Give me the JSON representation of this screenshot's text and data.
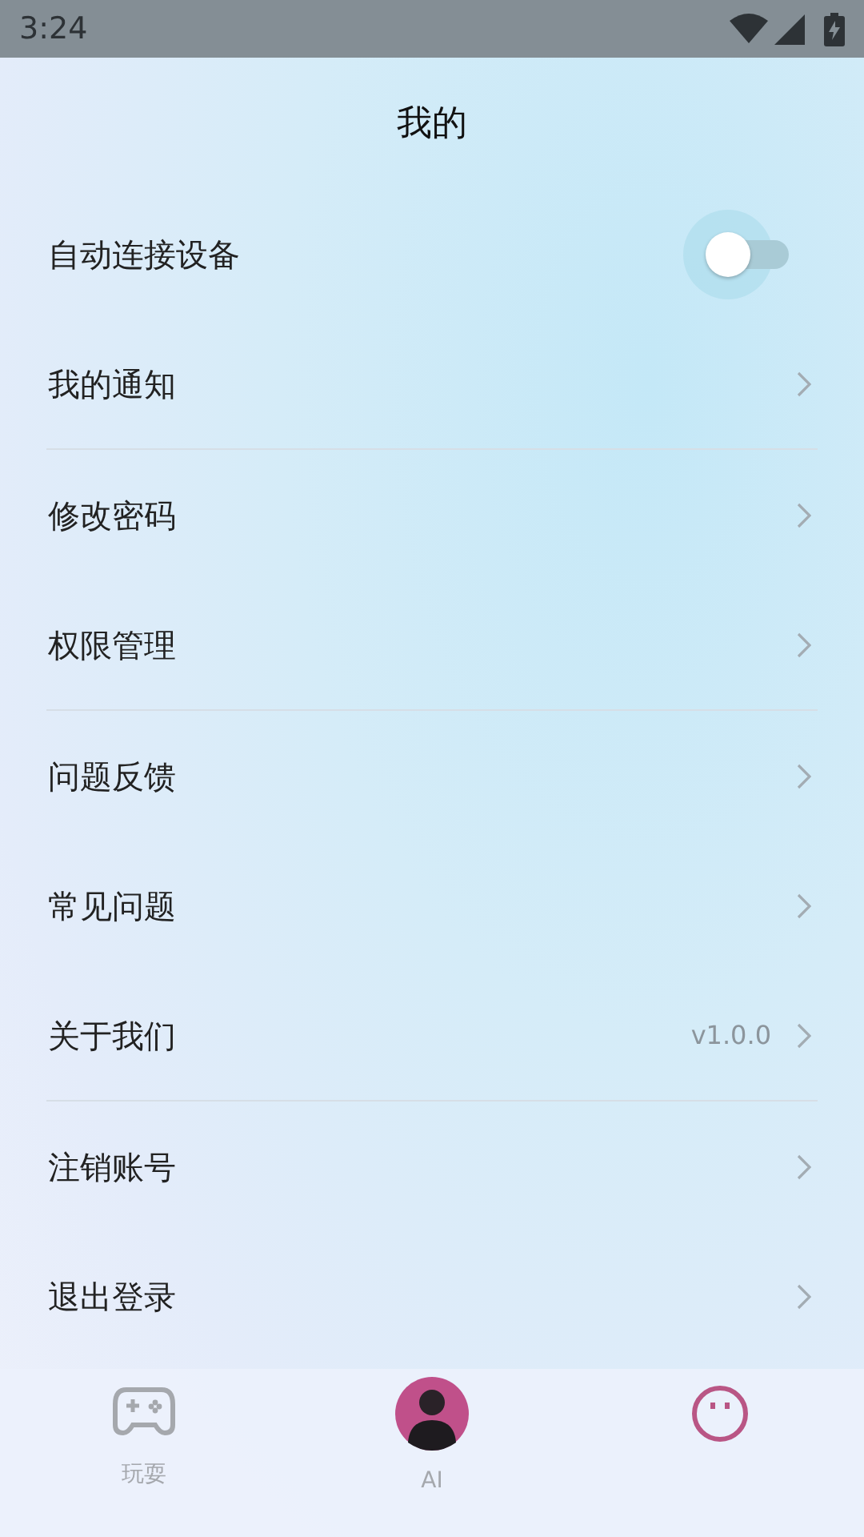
{
  "status_bar": {
    "time": "3:24"
  },
  "title": "我的",
  "groups": [
    {
      "items": [
        {
          "kind": "toggle",
          "label": "自动连接设备",
          "on": false
        },
        {
          "kind": "link",
          "label": "我的通知"
        }
      ]
    },
    {
      "items": [
        {
          "kind": "link",
          "label": "修改密码"
        },
        {
          "kind": "link",
          "label": "权限管理"
        }
      ]
    },
    {
      "items": [
        {
          "kind": "link",
          "label": "问题反馈"
        },
        {
          "kind": "link",
          "label": "常见问题"
        },
        {
          "kind": "link",
          "label": "关于我们",
          "value": "v1.0.0"
        }
      ]
    },
    {
      "items": [
        {
          "kind": "link",
          "label": "注销账号"
        },
        {
          "kind": "link",
          "label": "退出登录"
        }
      ]
    }
  ],
  "tabs": [
    {
      "kind": "game",
      "label": "玩耍",
      "selected": false
    },
    {
      "kind": "avatar",
      "label": "AI",
      "selected": false
    },
    {
      "kind": "face",
      "selected": true
    }
  ]
}
